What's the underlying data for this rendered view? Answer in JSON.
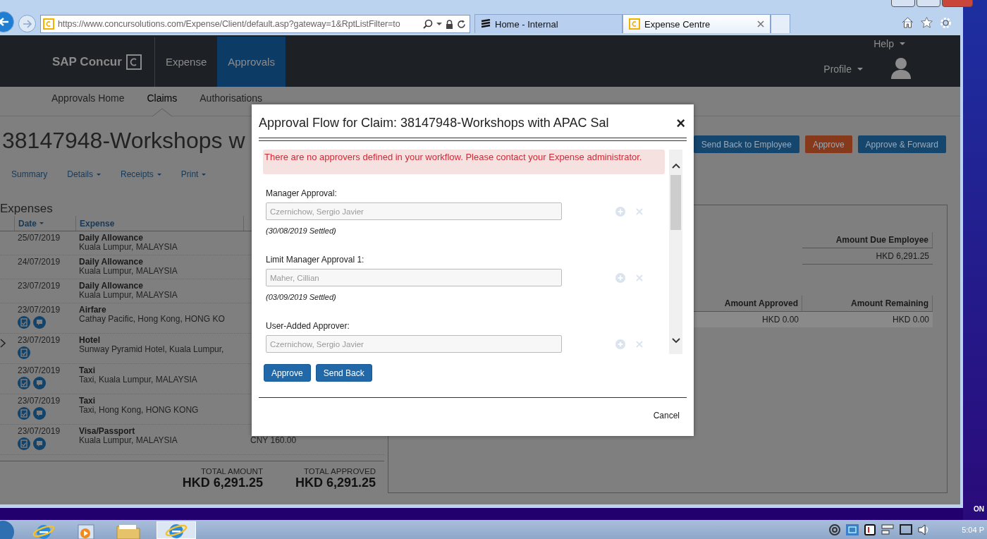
{
  "browser": {
    "back_button": {
      "disabled": false
    },
    "address": "https://www.concursolutions.com/Expense/Client/default.asp?gateway=1&RptListFilter=to",
    "tabs": [
      {
        "label": "Home - Internal",
        "selected": false,
        "kind": "stripes"
      },
      {
        "label": "Expense Centre",
        "selected": true,
        "kind": "concur"
      }
    ]
  },
  "header": {
    "logo": "SAP Concur",
    "nav": [
      {
        "label": "Expense",
        "selected": false
      },
      {
        "label": "Approvals",
        "selected": true
      }
    ],
    "help": "Help",
    "profile": "Profile"
  },
  "subnav": [
    {
      "label": "Approvals Home",
      "selected": false
    },
    {
      "label": "Claims",
      "selected": true
    },
    {
      "label": "Authorisations",
      "selected": false
    }
  ],
  "claim": {
    "title": "38147948-Workshops w",
    "actions": [
      {
        "label": "Send Back to Employee",
        "kind": "primary"
      },
      {
        "label": "Approve",
        "kind": "danger"
      },
      {
        "label": "Approve & Forward",
        "kind": "primary"
      }
    ],
    "tabs": [
      {
        "label": "Summary",
        "dropdown": false
      },
      {
        "label": "Details",
        "dropdown": true
      },
      {
        "label": "Receipts",
        "dropdown": true
      },
      {
        "label": "Print",
        "dropdown": true
      }
    ]
  },
  "expenses": {
    "heading": "Expenses",
    "columns": [
      {
        "label": "Date",
        "sorted": true
      },
      {
        "label": "Expense",
        "sorted": false
      }
    ],
    "rows": [
      {
        "date": "25/07/2019",
        "type": "Daily Allowance",
        "detail": "Kuala Lumpur, MALAYSIA",
        "amount": [],
        "receipt": false,
        "comment": false,
        "selected": false
      },
      {
        "date": "24/07/2019",
        "type": "Daily Allowance",
        "detail": "Kuala Lumpur, MALAYSIA",
        "amount": [],
        "receipt": false,
        "comment": false,
        "selected": false
      },
      {
        "date": "23/07/2019",
        "type": "Daily Allowance",
        "detail": "Kuala Lumpur, MALAYSIA",
        "amount": [],
        "receipt": false,
        "comment": false,
        "selected": false
      },
      {
        "date": "23/07/2019",
        "type": "Airfare",
        "detail": "Cathay Pacific, Hong Kong, HONG KO",
        "amount": [],
        "receipt": true,
        "comment": true,
        "selected": false
      },
      {
        "date": "23/07/2019",
        "type": "Hotel",
        "detail": "Sunway Pyramid Hotel, Kuala Lumpur,",
        "amount": [],
        "receipt": true,
        "comment": false,
        "selected": true
      },
      {
        "date": "23/07/2019",
        "type": "Taxi",
        "detail": "Taxi, Kuala Lumpur, MALAYSIA",
        "amount": [],
        "receipt": true,
        "comment": true,
        "selected": false
      },
      {
        "date": "23/07/2019",
        "type": "Taxi",
        "detail": "Taxi, Hong Kong, HONG KONG",
        "amount": [],
        "receipt": true,
        "comment": true,
        "selected": false
      },
      {
        "date": "23/07/2019",
        "type": "Visa/Passport",
        "detail": "Kuala Lumpur, MALAYSIA",
        "amount": [
          "CNY 160.00"
        ],
        "receipt": true,
        "comment": true,
        "selected": false
      }
    ],
    "totals": [
      {
        "label": "TOTAL AMOUNT",
        "value": "HKD 6,291.25"
      },
      {
        "label": "TOTAL APPROVED",
        "value": "HKD 6,291.25"
      }
    ]
  },
  "summary": {
    "due_table": {
      "columns": [
        "Amount Due Employee"
      ],
      "rows": [
        [
          "HKD 6,291.25"
        ]
      ]
    },
    "approval_table": {
      "columns": [
        "Amount Approved",
        "Amount Remaining"
      ],
      "rows": [
        [
          "HKD 0.00",
          "HKD 0.00"
        ]
      ]
    }
  },
  "dialog": {
    "title": "Approval Flow for Claim: 38147948-Workshops with APAC Sal",
    "close": "×",
    "alert": "There are no approvers defined in your workflow. Please contact your Expense administrator.",
    "approvers": [
      {
        "label": "Manager Approval:",
        "value": "Czernichow, Sergio Javier",
        "note": "(30/08/2019 Settled)",
        "disabled": true
      },
      {
        "label": "Limit Manager Approval 1:",
        "value": "Maher, Cillian",
        "note": "(03/09/2019 Settled)",
        "disabled": true
      },
      {
        "label": "User-Added Approver:",
        "value": "Czernichow, Sergio Javier",
        "disabled": true
      }
    ],
    "buttons": [
      "Approve",
      "Send Back"
    ],
    "cancel": "Cancel"
  },
  "desktop": {
    "label": "ON"
  },
  "taskbar": {
    "items": [
      {
        "kind": "browser",
        "active": false
      },
      {
        "kind": "media",
        "active": false
      },
      {
        "kind": "folder",
        "active": false
      },
      {
        "kind": "browser",
        "active": true
      }
    ],
    "clock": "5:04 P"
  }
}
